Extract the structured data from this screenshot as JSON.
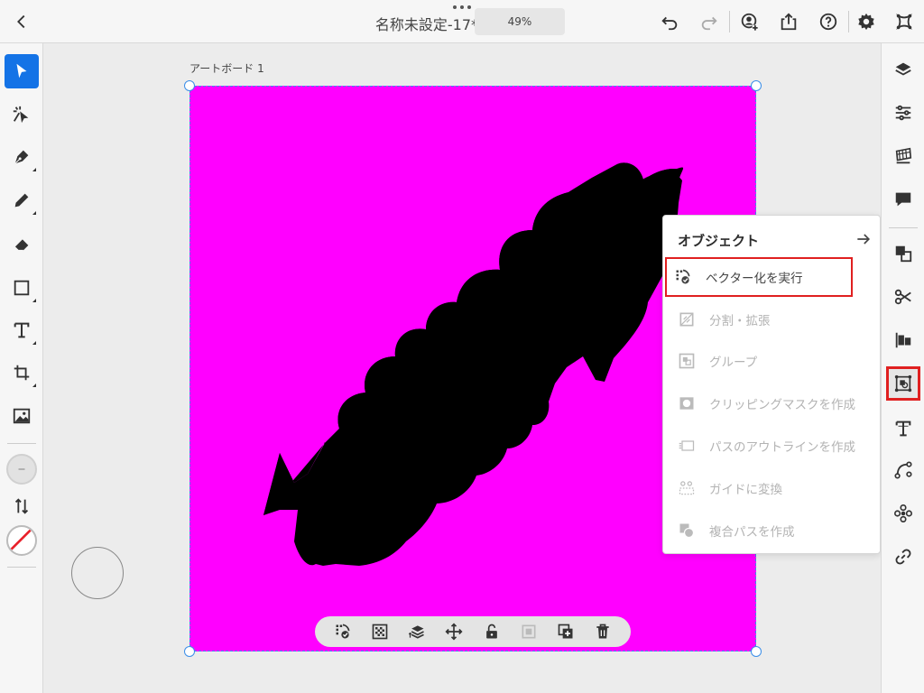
{
  "topbar": {
    "back_icon": "chevron-left-icon",
    "title": "名称未設定-17*",
    "zoom": "49%",
    "undo_icon": "undo-icon",
    "redo_icon": "redo-icon",
    "invite_icon": "add-user-icon",
    "share_icon": "share-icon",
    "help_icon": "help-icon",
    "settings_icon": "gear-icon",
    "livestream_icon": "livestream-icon"
  },
  "left_tools": [
    {
      "name": "selection-tool",
      "icon": "arrow-cursor-icon",
      "active": true
    },
    {
      "name": "direct-selection-tool",
      "icon": "direct-select-icon"
    },
    {
      "name": "pen-tool",
      "icon": "pen-icon"
    },
    {
      "name": "pencil-tool",
      "icon": "pencil-icon"
    },
    {
      "name": "eraser-tool",
      "icon": "eraser-icon"
    },
    {
      "name": "rectangle-tool",
      "icon": "rectangle-icon"
    },
    {
      "name": "type-tool",
      "icon": "type-icon"
    },
    {
      "name": "crop-tool",
      "icon": "crop-icon"
    },
    {
      "name": "image-tool",
      "icon": "image-icon"
    }
  ],
  "colors": {
    "accent": "#1473e6",
    "artboard_fill": "#ff00ff",
    "shape_fill": "#000000",
    "highlight_red": "#e02020",
    "selection_blue": "#3b8ee8"
  },
  "canvas": {
    "artboard_label": "アートボード 1"
  },
  "popover": {
    "title": "オブジェクト",
    "items": [
      {
        "label": "ベクター化を実行",
        "icon": "vectorize-icon",
        "enabled": true
      },
      {
        "label": "分割・拡張",
        "icon": "expand-icon",
        "enabled": false
      },
      {
        "label": "グループ",
        "icon": "group-icon",
        "enabled": false
      },
      {
        "label": "クリッピングマスクを作成",
        "icon": "clipping-mask-icon",
        "enabled": false
      },
      {
        "label": "パスのアウトラインを作成",
        "icon": "outline-stroke-icon",
        "enabled": false
      },
      {
        "label": "ガイドに変換",
        "icon": "guide-icon",
        "enabled": false
      },
      {
        "label": "複合パスを作成",
        "icon": "compound-path-icon",
        "enabled": false
      }
    ]
  },
  "right_panels": [
    "layers-icon",
    "properties-icon",
    "swatches-icon",
    "comments-icon",
    "transform-icon",
    "scissors-icon",
    "align-icon",
    "object-icon",
    "character-icon",
    "path-icon",
    "repeat-icon",
    "link-icon"
  ],
  "context_toolbar": [
    "vectorize-icon",
    "opacity-icon",
    "arrange-icon",
    "move-icon",
    "lock-icon",
    "duplicate-disabled-icon",
    "duplicate-icon",
    "trash-icon"
  ]
}
